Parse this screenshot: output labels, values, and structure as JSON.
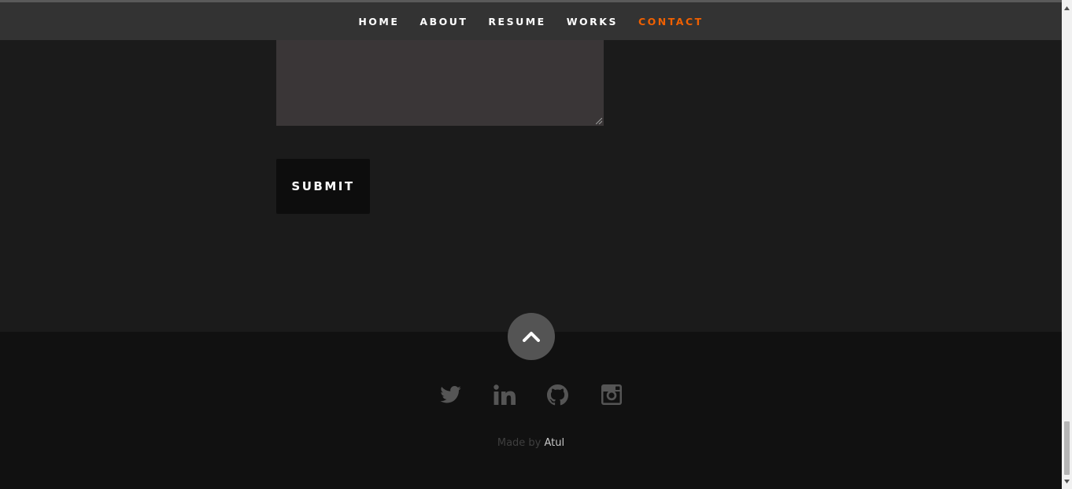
{
  "nav": {
    "items": [
      {
        "label": "HOME",
        "active": false
      },
      {
        "label": "ABOUT",
        "active": false
      },
      {
        "label": "RESUME",
        "active": false
      },
      {
        "label": "WORKS",
        "active": false
      },
      {
        "label": "CONTACT",
        "active": true
      }
    ]
  },
  "contact": {
    "message_value": "",
    "submit_label": "SUBMIT"
  },
  "footer": {
    "go_top_icon": "chevron-up-icon",
    "social": [
      {
        "name": "twitter-icon"
      },
      {
        "name": "linkedin-icon"
      },
      {
        "name": "github-icon"
      },
      {
        "name": "instagram-icon"
      }
    ],
    "credits_prefix": "Made by",
    "credits_author": "Atul"
  },
  "colors": {
    "accent": "#f06000",
    "nav_bg": "#333333",
    "section_bg": "#1b1b1b",
    "footer_bg": "#111111",
    "icon_gray": "#555555"
  }
}
